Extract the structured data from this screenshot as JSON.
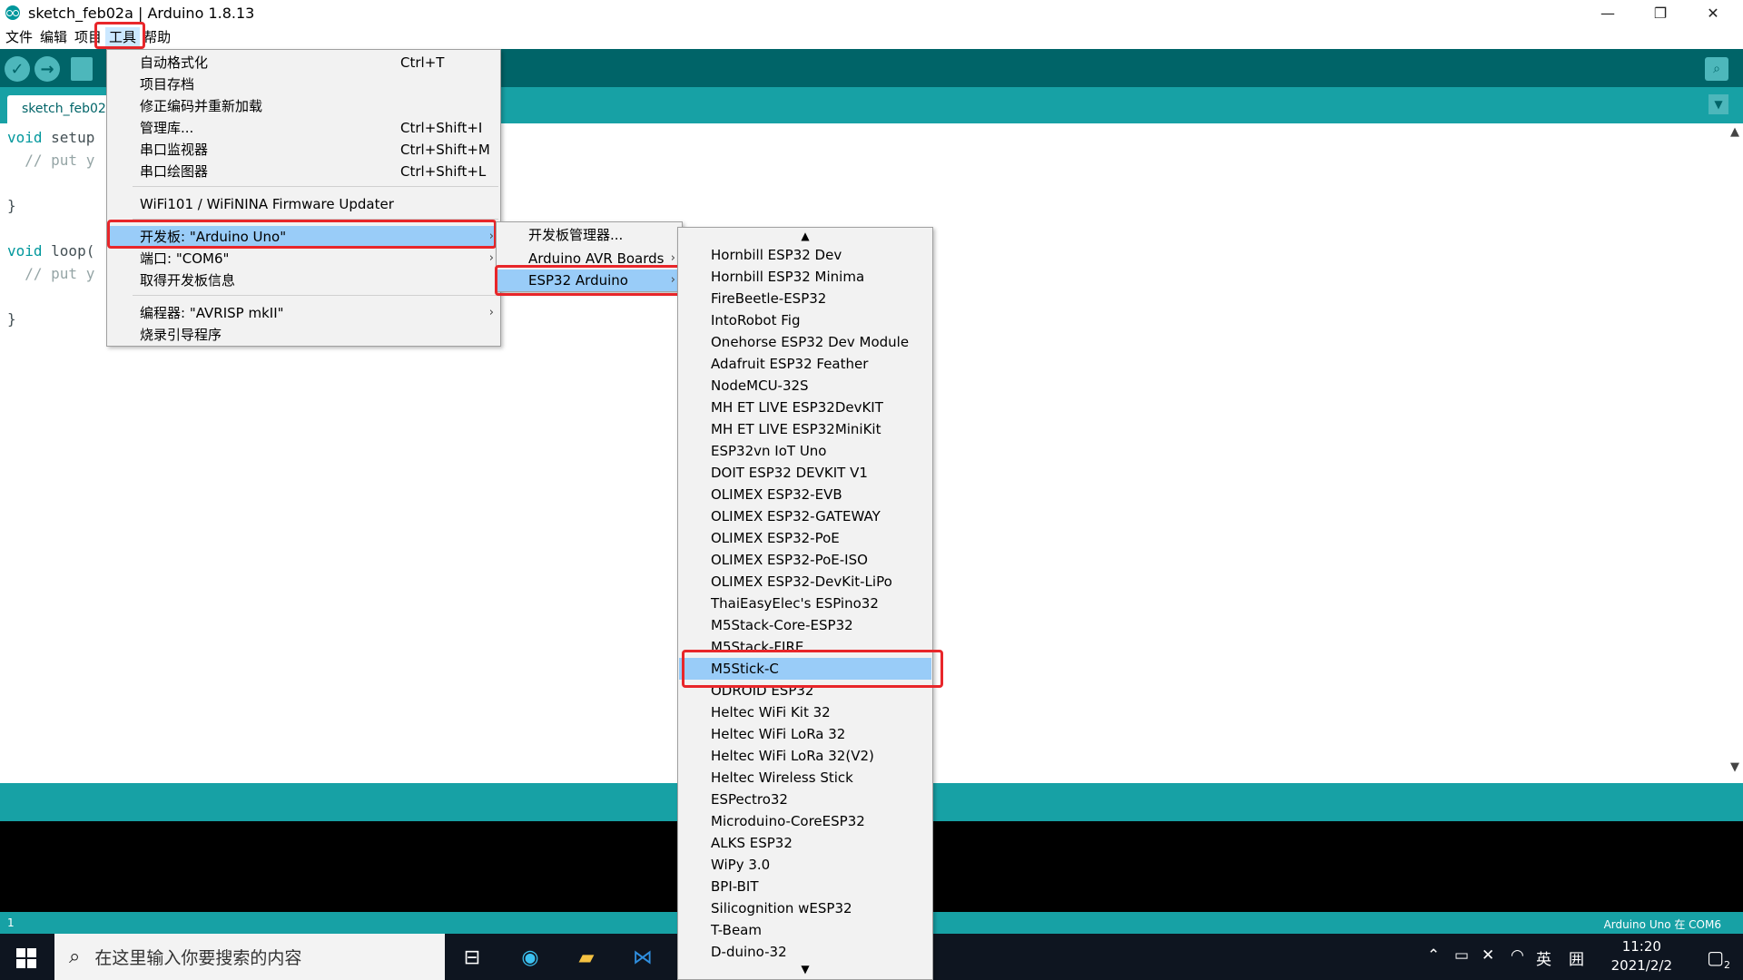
{
  "window": {
    "title": "sketch_feb02a | Arduino 1.8.13",
    "minimize": "—",
    "restore": "❐",
    "close": "✕"
  },
  "menubar": {
    "items": [
      "文件",
      "编辑",
      "项目",
      "工具",
      "帮助"
    ],
    "active": "工具"
  },
  "toolbar": {
    "verify_icon": "✓",
    "upload_icon": "→",
    "serial_icon": "⌕"
  },
  "tab": {
    "name": "sketch_feb02a",
    "menu_icon": "▼"
  },
  "editor": {
    "lines": [
      {
        "kw": "void",
        "rest": " setup"
      },
      {
        "kw": "",
        "rest": "  // put y"
      },
      {
        "kw": "",
        "rest": ""
      },
      {
        "kw": "",
        "rest": "}"
      },
      {
        "kw": "",
        "rest": ""
      },
      {
        "kw": "void",
        "rest": " loop("
      },
      {
        "kw": "",
        "rest": "  // put y"
      },
      {
        "kw": "",
        "rest": ""
      },
      {
        "kw": "",
        "rest": "}"
      }
    ],
    "scroll_up": "▲",
    "scroll_down": "▼"
  },
  "status": {
    "line": "1",
    "board": "Arduino Uno 在 COM6"
  },
  "tools_menu": {
    "items": [
      {
        "label": "自动格式化",
        "shortcut": "Ctrl+T"
      },
      {
        "label": "项目存档",
        "shortcut": ""
      },
      {
        "label": "修正编码并重新加载",
        "shortcut": ""
      },
      {
        "label": "管理库...",
        "shortcut": "Ctrl+Shift+I"
      },
      {
        "label": "串口监视器",
        "shortcut": "Ctrl+Shift+M"
      },
      {
        "label": "串口绘图器",
        "shortcut": "Ctrl+Shift+L"
      },
      {
        "label": "WiFi101 / WiFiNINA Firmware Updater",
        "shortcut": ""
      },
      {
        "label": "开发板: \"Arduino Uno\"",
        "shortcut": ""
      },
      {
        "label": "端口: \"COM6\"",
        "shortcut": ""
      },
      {
        "label": "取得开发板信息",
        "shortcut": ""
      },
      {
        "label": "编程器: \"AVRISP mkII\"",
        "shortcut": ""
      },
      {
        "label": "烧录引导程序",
        "shortcut": ""
      }
    ],
    "highlighted": "开发板: \"Arduino Uno\""
  },
  "board_menu": {
    "items": [
      "开发板管理器...",
      "Arduino AVR Boards",
      "ESP32 Arduino"
    ],
    "highlighted": "ESP32 Arduino"
  },
  "esp32_menu": {
    "scroll_up": "▲",
    "scroll_down": "▼",
    "items": [
      "Hornbill ESP32 Dev",
      "Hornbill ESP32 Minima",
      "FireBeetle-ESP32",
      "IntoRobot Fig",
      "Onehorse ESP32 Dev Module",
      "Adafruit ESP32 Feather",
      "NodeMCU-32S",
      "MH ET LIVE ESP32DevKIT",
      "MH ET LIVE ESP32MiniKit",
      "ESP32vn IoT Uno",
      "DOIT ESP32 DEVKIT V1",
      "OLIMEX ESP32-EVB",
      "OLIMEX ESP32-GATEWAY",
      "OLIMEX ESP32-PoE",
      "OLIMEX ESP32-PoE-ISO",
      "OLIMEX ESP32-DevKit-LiPo",
      "ThaiEasyElec's ESPino32",
      "M5Stack-Core-ESP32",
      "M5Stack-FIRE",
      "M5Stick-C",
      "ODROID ESP32",
      "Heltec WiFi Kit 32",
      "Heltec WiFi LoRa 32",
      "Heltec WiFi LoRa 32(V2)",
      "Heltec Wireless Stick",
      "ESPectro32",
      "Microduino-CoreESP32",
      "ALKS ESP32",
      "WiPy 3.0",
      "BPI-BIT",
      "Silicognition wESP32",
      "T-Beam",
      "D-duino-32"
    ],
    "highlighted": "M5Stick-C"
  },
  "taskbar": {
    "search_placeholder": "在这里输入你要搜索的内容",
    "ime": "英",
    "ime2": "囲",
    "time": "11:20",
    "date": "2021/2/2",
    "notification_count": "2"
  }
}
